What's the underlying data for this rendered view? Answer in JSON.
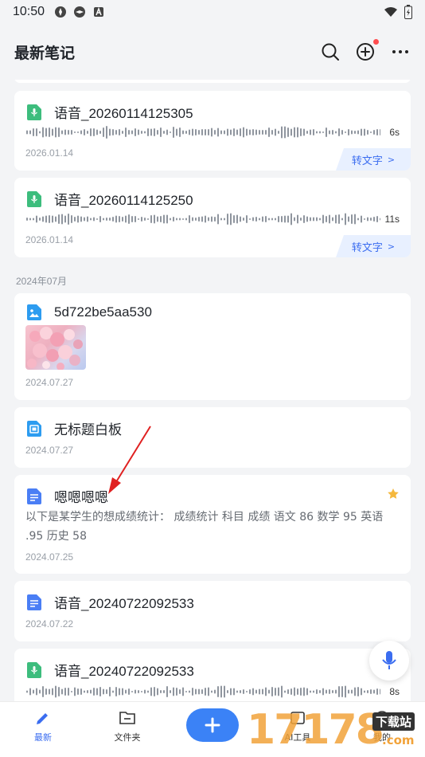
{
  "status_bar": {
    "time": "10:50"
  },
  "header": {
    "title": "最新笔记"
  },
  "notes": [
    {
      "type": "audio",
      "title": "语音_20260114125305",
      "duration": "6s",
      "date": "2026.01.14",
      "action": "转文字"
    },
    {
      "type": "audio",
      "title": "语音_20260114125250",
      "duration": "11s",
      "date": "2026.01.14",
      "action": "转文字"
    }
  ],
  "section": {
    "label": "2024年07月"
  },
  "notes_2024": [
    {
      "type": "image",
      "title": "5d722be5aa530",
      "date": "2024.07.27"
    },
    {
      "type": "whiteboard",
      "title": "无标题白板",
      "date": "2024.07.27"
    },
    {
      "type": "doc",
      "title": "嗯嗯嗯嗯",
      "desc": "以下是某学生的想成绩统计：   成绩统计 科目 成绩 语文 86 数学 95 英语 .95 历史 58",
      "date": "2024.07.25",
      "starred": true
    },
    {
      "type": "doc",
      "title": "语音_20240722092533",
      "date": "2024.07.22"
    },
    {
      "type": "audio",
      "title": "语音_20240722092533",
      "duration": "8s"
    }
  ],
  "tabs": [
    {
      "label": "最新",
      "icon": "pen-icon",
      "active": true
    },
    {
      "label": "文件夹",
      "icon": "folder-icon",
      "active": false
    },
    {
      "label": "AI工具",
      "icon": "ai-tool-icon",
      "active": false
    },
    {
      "label": "我的",
      "icon": "profile-icon",
      "active": false
    }
  ],
  "watermark": {
    "text": "17178",
    "badge": "下载站",
    "domain": ".com"
  },
  "colors": {
    "accent": "#3b6df0",
    "audio_green": "#3dbd7d",
    "image_blue": "#2d9cf0",
    "doc_blue": "#4a7ef5",
    "star": "#f5b83d",
    "annotation_red": "#e02020"
  }
}
